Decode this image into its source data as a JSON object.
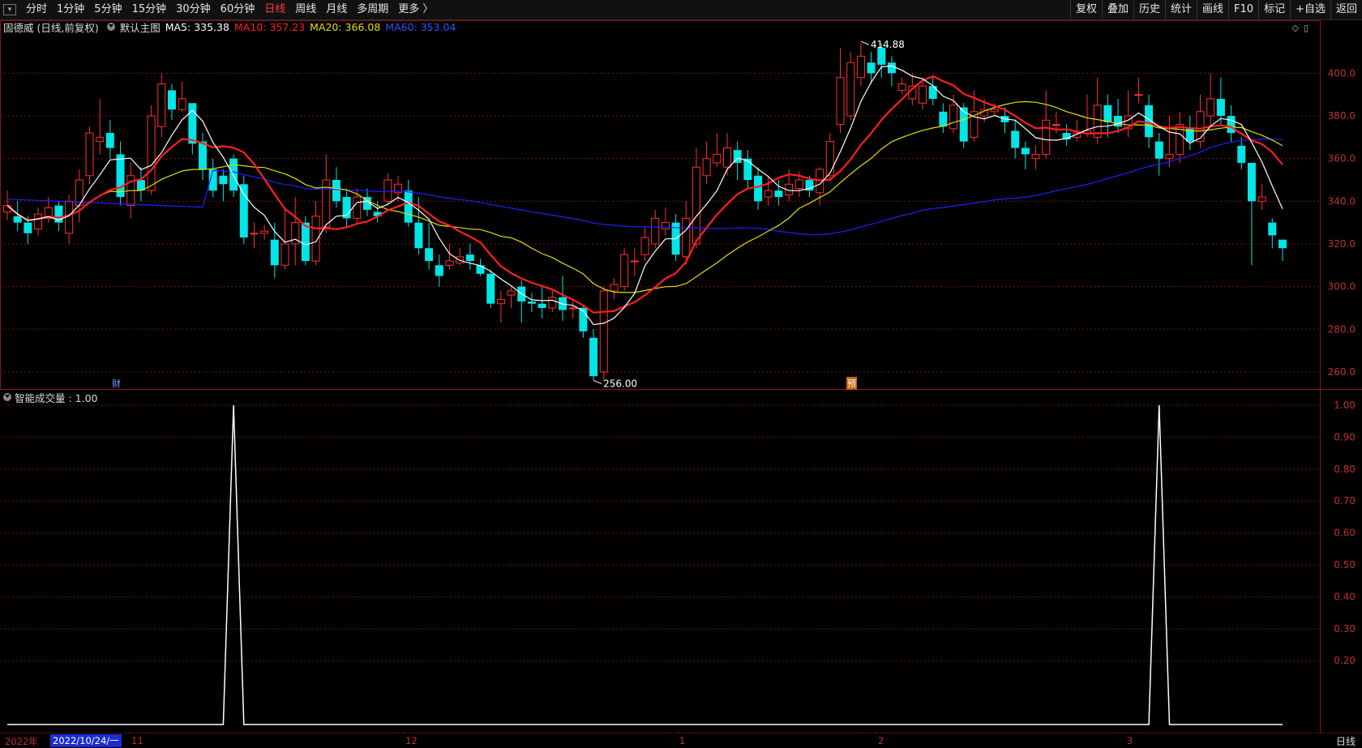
{
  "toolbar": {
    "left": [
      "分时",
      "1分钟",
      "5分钟",
      "15分钟",
      "30分钟",
      "60分钟",
      "日线",
      "周线",
      "月线",
      "多周期",
      "更多 〉"
    ],
    "active": "日线",
    "right": [
      "复权",
      "叠加",
      "历史",
      "统计",
      "画线",
      "F10",
      "+自选",
      "返回"
    ],
    "mark_label": "标记"
  },
  "info": {
    "stock": "固德威 (日线,前复权)",
    "chart_name": "默认主图",
    "ma5": "MA5: 335.38",
    "ma10": "MA10: 357.23",
    "ma20": "MA20: 366.08",
    "ma60": "MA60: 353.04"
  },
  "colors": {
    "ma5": "#ffffff",
    "ma10": "#ff2020",
    "ma20": "#e0e000",
    "ma60": "#2020ff",
    "up": "#ff3030",
    "down": "#00e5e5",
    "grid": "#7a1010"
  },
  "price_axis": [
    "400.0",
    "380.0",
    "360.0",
    "340.0",
    "320.0",
    "300.0",
    "280.0",
    "260.0"
  ],
  "annotations": {
    "high": "414.88",
    "low": "256.00",
    "cai": "财",
    "yu": "预"
  },
  "sub": {
    "title": "智能成交量 : 1.00",
    "axis": [
      "1.00",
      "0.90",
      "0.80",
      "0.70",
      "0.60",
      "0.50",
      "0.40",
      "0.30",
      "0.20"
    ]
  },
  "dates": {
    "year": "2022年",
    "selected": "2022/10/24/一",
    "months": [
      "11",
      "12",
      "1",
      "2",
      "3"
    ]
  },
  "period": "日线",
  "chart_data": {
    "type": "candlestick",
    "candles": [
      [
        335,
        338,
        345,
        331
      ],
      [
        333,
        330,
        340,
        326
      ],
      [
        330,
        325,
        333,
        320
      ],
      [
        327,
        334,
        337,
        324
      ],
      [
        332,
        337,
        342,
        330
      ],
      [
        338,
        330,
        340,
        326
      ],
      [
        325,
        340,
        343,
        320
      ],
      [
        338,
        350,
        355,
        330
      ],
      [
        352,
        372,
        375,
        348
      ],
      [
        368,
        370,
        388,
        362
      ],
      [
        372,
        365,
        378,
        360
      ],
      [
        362,
        342,
        368,
        338
      ],
      [
        338,
        352,
        358,
        332
      ],
      [
        350,
        345,
        356,
        340
      ],
      [
        345,
        380,
        385,
        343
      ],
      [
        375,
        395,
        400,
        370
      ],
      [
        392,
        383,
        395,
        378
      ],
      [
        383,
        388,
        396,
        382
      ],
      [
        386,
        367,
        380,
        362
      ],
      [
        368,
        355,
        372,
        350
      ],
      [
        355,
        345,
        360,
        342
      ],
      [
        352,
        348,
        355,
        340
      ],
      [
        360,
        345,
        362,
        342
      ],
      [
        348,
        323,
        352,
        320
      ],
      [
        325,
        325,
        330,
        318
      ],
      [
        325,
        326,
        329,
        322
      ],
      [
        322,
        310,
        330,
        304
      ],
      [
        310,
        320,
        336,
        308
      ],
      [
        320,
        330,
        342,
        310
      ],
      [
        330,
        312,
        333,
        310
      ],
      [
        312,
        333,
        340,
        310
      ],
      [
        328,
        350,
        362,
        325
      ],
      [
        350,
        340,
        356,
        337
      ],
      [
        342,
        332,
        346,
        328
      ],
      [
        332,
        342,
        346,
        330
      ],
      [
        342,
        336,
        346,
        333
      ],
      [
        335,
        333,
        340,
        330
      ],
      [
        340,
        350,
        353,
        338
      ],
      [
        344,
        348,
        352,
        340
      ],
      [
        345,
        330,
        350,
        328
      ],
      [
        330,
        318,
        342,
        315
      ],
      [
        318,
        312,
        330,
        308
      ],
      [
        310,
        305,
        315,
        300
      ],
      [
        310,
        312,
        320,
        308
      ],
      [
        311,
        314,
        318,
        310
      ],
      [
        315,
        312,
        320,
        308
      ],
      [
        310,
        306,
        313,
        305
      ],
      [
        306,
        292,
        308,
        290
      ],
      [
        292,
        294,
        298,
        283
      ],
      [
        296,
        298,
        300,
        290
      ],
      [
        300,
        293,
        303,
        283
      ],
      [
        293,
        292,
        297,
        288
      ],
      [
        292,
        290,
        300,
        285
      ],
      [
        290,
        295,
        298,
        288
      ],
      [
        295,
        289,
        305,
        284
      ],
      [
        290,
        290,
        294,
        285
      ],
      [
        290,
        279,
        291,
        276
      ],
      [
        276,
        258,
        280,
        256
      ],
      [
        260,
        298,
        300,
        256
      ],
      [
        298,
        301,
        304,
        294
      ],
      [
        300,
        315,
        318,
        298
      ],
      [
        312,
        312,
        318,
        305
      ],
      [
        315,
        323,
        328,
        312
      ],
      [
        320,
        332,
        336,
        318
      ],
      [
        327,
        330,
        337,
        324
      ],
      [
        330,
        315,
        334,
        312
      ],
      [
        314,
        332,
        340,
        310
      ],
      [
        320,
        356,
        365,
        318
      ],
      [
        352,
        360,
        368,
        348
      ],
      [
        358,
        362,
        372,
        356
      ],
      [
        356,
        365,
        372,
        352
      ],
      [
        364,
        358,
        368,
        350
      ],
      [
        360,
        350,
        364,
        346
      ],
      [
        352,
        340,
        356,
        336
      ],
      [
        342,
        345,
        352,
        338
      ],
      [
        345,
        342,
        350,
        338
      ],
      [
        343,
        348,
        355,
        340
      ],
      [
        346,
        350,
        354,
        342
      ],
      [
        350,
        345,
        352,
        342
      ],
      [
        344,
        355,
        356,
        338
      ],
      [
        352,
        368,
        372,
        350
      ],
      [
        376,
        398,
        412,
        372
      ],
      [
        380,
        405,
        410,
        378
      ],
      [
        398,
        408,
        414,
        394
      ],
      [
        405,
        400,
        410,
        395
      ],
      [
        412,
        404,
        414,
        398
      ],
      [
        405,
        400,
        408,
        394
      ],
      [
        392,
        395,
        398,
        390
      ],
      [
        388,
        394,
        400,
        385
      ],
      [
        386,
        394,
        398,
        383
      ],
      [
        394,
        388,
        398,
        385
      ],
      [
        382,
        375,
        386,
        372
      ],
      [
        374,
        385,
        390,
        372
      ],
      [
        384,
        368,
        386,
        365
      ],
      [
        370,
        382,
        392,
        368
      ],
      [
        380,
        383,
        388,
        377
      ],
      [
        382,
        383,
        386,
        380
      ],
      [
        380,
        377,
        384,
        372
      ],
      [
        373,
        365,
        378,
        360
      ],
      [
        365,
        362,
        368,
        355
      ],
      [
        360,
        362,
        366,
        355
      ],
      [
        362,
        378,
        392,
        360
      ],
      [
        376,
        376,
        382,
        372
      ],
      [
        372,
        369,
        376,
        366
      ],
      [
        370,
        372,
        378,
        368
      ],
      [
        372,
        373,
        390,
        370
      ],
      [
        370,
        385,
        398,
        367
      ],
      [
        385,
        377,
        390,
        370
      ],
      [
        380,
        375,
        388,
        372
      ],
      [
        374,
        380,
        392,
        370
      ],
      [
        390,
        390,
        398,
        386
      ],
      [
        385,
        370,
        390,
        365
      ],
      [
        368,
        360,
        372,
        352
      ],
      [
        360,
        362,
        380,
        356
      ],
      [
        362,
        376,
        382,
        358
      ],
      [
        374,
        368,
        380,
        364
      ],
      [
        368,
        382,
        390,
        365
      ],
      [
        380,
        388,
        400,
        375
      ],
      [
        388,
        380,
        398,
        376
      ],
      [
        380,
        372,
        385,
        368
      ],
      [
        366,
        358,
        370,
        355
      ],
      [
        358,
        340,
        352,
        310
      ],
      [
        340,
        342,
        348,
        336
      ],
      [
        330,
        324,
        332,
        318
      ],
      [
        322,
        318,
        320,
        312
      ]
    ],
    "ma5_last": 335.38,
    "ma10_last": 357.23,
    "ma20_last": 366.08,
    "ma60_last": 353.04,
    "ylim": [
      252,
      418
    ],
    "volume_indicator": {
      "name": "智能成交量",
      "spikes_at": [
        22,
        112
      ],
      "max": 1.0,
      "min": 0.0
    }
  }
}
